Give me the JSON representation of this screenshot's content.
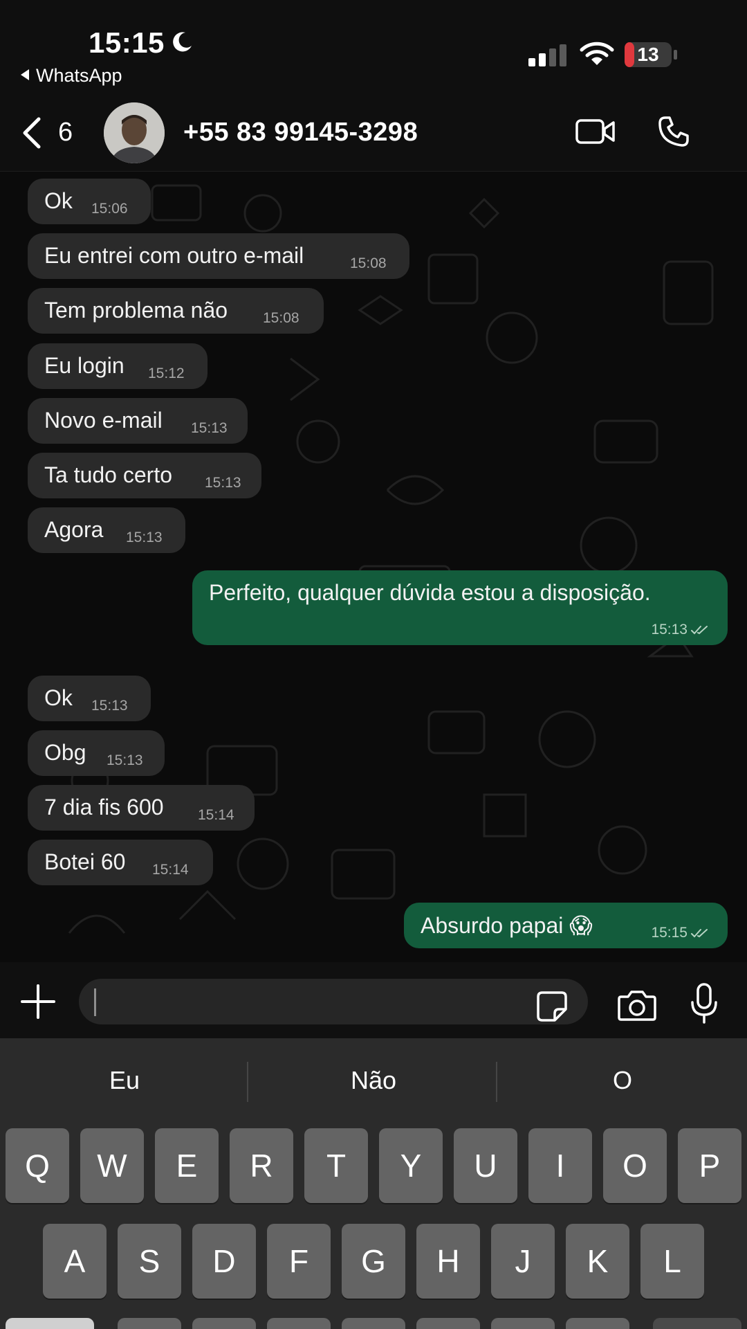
{
  "status_bar": {
    "time": "15:15",
    "back_app": "WhatsApp",
    "battery_level": "13"
  },
  "header": {
    "unread_count": "6",
    "contact_name": "+55 83 99145-3298"
  },
  "messages": [
    {
      "dir": "in",
      "text": "Ok",
      "time": "15:06"
    },
    {
      "dir": "in",
      "text": "Eu entrei com outro e-mail",
      "time": "15:08"
    },
    {
      "dir": "in",
      "text": "Tem problema não",
      "time": "15:08"
    },
    {
      "dir": "in",
      "text": "Eu login",
      "time": "15:12"
    },
    {
      "dir": "in",
      "text": "Novo e-mail",
      "time": "15:13"
    },
    {
      "dir": "in",
      "text": "Ta tudo certo",
      "time": "15:13"
    },
    {
      "dir": "in",
      "text": "Agora",
      "time": "15:13"
    },
    {
      "dir": "out",
      "text": "Perfeito, qualquer dúvida estou a disposição.",
      "time": "15:13"
    },
    {
      "dir": "in",
      "text": "Ok",
      "time": "15:13"
    },
    {
      "dir": "in",
      "text": "Obg",
      "time": "15:13"
    },
    {
      "dir": "in",
      "text": "7 dia fis 600",
      "time": "15:14"
    },
    {
      "dir": "in",
      "text": "Botei 60",
      "time": "15:14"
    },
    {
      "dir": "out",
      "text": "Absurdo papai 😱",
      "time": "15:15"
    }
  ],
  "keyboard": {
    "suggestions": [
      "Eu",
      "Não",
      "O"
    ],
    "row1": [
      "Q",
      "W",
      "E",
      "R",
      "T",
      "Y",
      "U",
      "I",
      "O",
      "P"
    ],
    "row2": [
      "A",
      "S",
      "D",
      "F",
      "G",
      "H",
      "J",
      "K",
      "L"
    ]
  },
  "colors": {
    "incoming_bubble": "#2a2a2a",
    "outgoing_bubble": "#135c3c",
    "background": "#0b0b0b",
    "battery_low": "#e0393e"
  },
  "icons": [
    "moon-icon",
    "signal-icon",
    "wifi-icon",
    "battery-icon",
    "back-chevron-icon",
    "video-call-icon",
    "phone-call-icon",
    "plus-icon",
    "sticker-icon",
    "camera-icon",
    "microphone-icon",
    "double-check-icon"
  ]
}
